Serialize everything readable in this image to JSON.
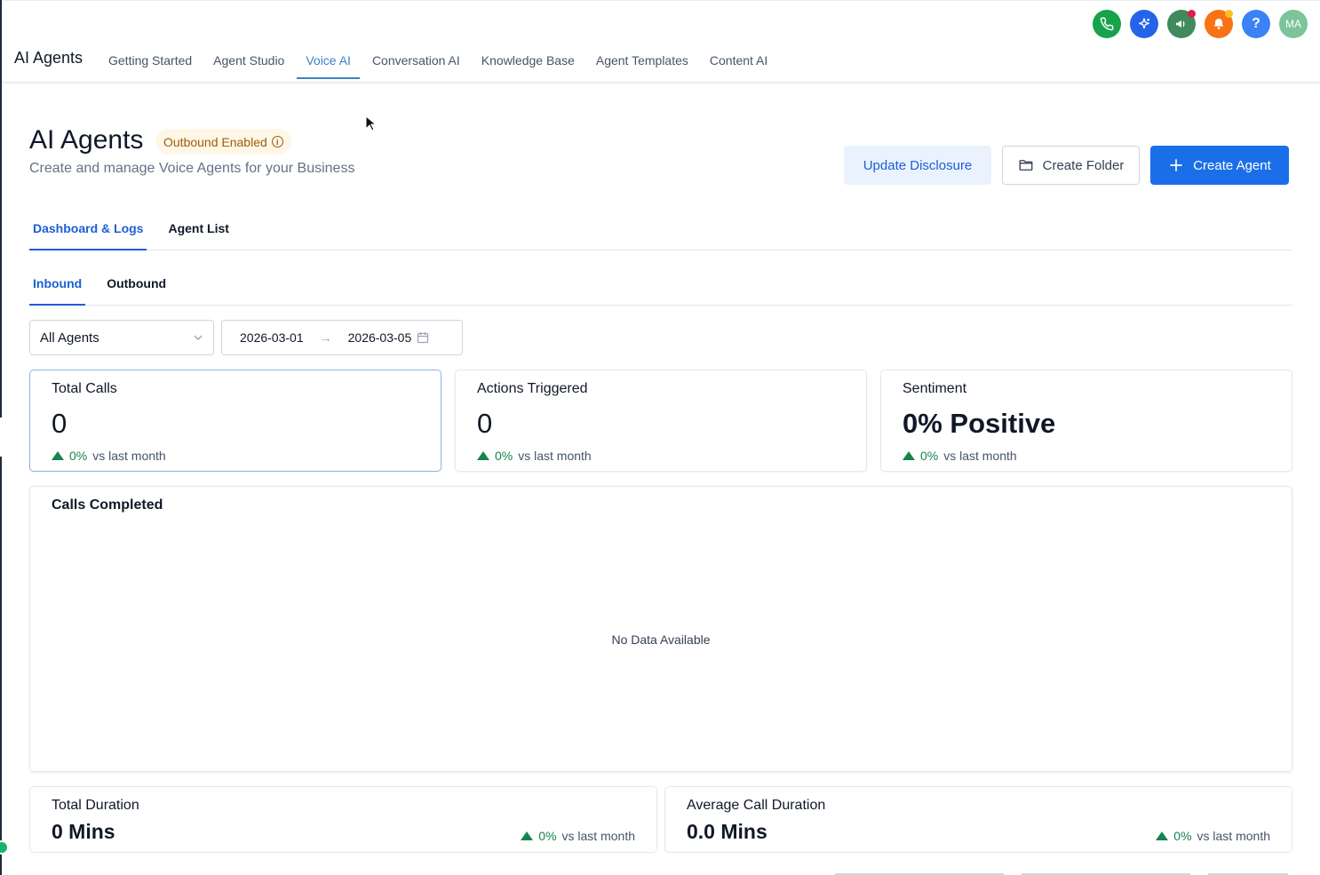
{
  "header": {
    "app_title": "AI Agents",
    "nav": [
      {
        "label": "Getting Started",
        "active": false
      },
      {
        "label": "Agent Studio",
        "active": false
      },
      {
        "label": "Voice AI",
        "active": true
      },
      {
        "label": "Conversation AI",
        "active": false
      },
      {
        "label": "Knowledge Base",
        "active": false
      },
      {
        "label": "Agent Templates",
        "active": false
      },
      {
        "label": "Content AI",
        "active": false
      }
    ],
    "icons": [
      "phone-icon",
      "ai-sparkle-icon",
      "megaphone-icon",
      "bell-icon",
      "help-icon",
      "avatar"
    ],
    "help_glyph": "?",
    "avatar_initials": "MA"
  },
  "page": {
    "title": "AI Agents",
    "badge": "Outbound Enabled",
    "badge_info_glyph": "i",
    "subtitle": "Create and manage Voice Agents for your Business",
    "buttons": {
      "update_disclosure": "Update Disclosure",
      "create_folder": "Create Folder",
      "create_agent": "Create Agent"
    }
  },
  "tabs": {
    "primary": [
      {
        "label": "Dashboard & Logs",
        "active": true
      },
      {
        "label": "Agent List",
        "active": false
      }
    ],
    "secondary": [
      {
        "label": "Inbound",
        "active": true
      },
      {
        "label": "Outbound",
        "active": false
      }
    ]
  },
  "filters": {
    "agent_select": "All Agents",
    "date_from": "2026-03-01",
    "date_arrow": "→",
    "date_to": "2026-03-05"
  },
  "stats": [
    {
      "label": "Total Calls",
      "value": "0",
      "trend_pct": "0%",
      "trend_text": "vs last month"
    },
    {
      "label": "Actions Triggered",
      "value": "0",
      "trend_pct": "0%",
      "trend_text": "vs last month"
    },
    {
      "label": "Sentiment",
      "value": "0% Positive",
      "trend_pct": "0%",
      "trend_text": "vs last month"
    }
  ],
  "calls_completed": {
    "title": "Calls Completed",
    "empty_text": "No Data Available"
  },
  "durations": [
    {
      "label": "Total Duration",
      "value": "0 Mins",
      "trend_pct": "0%",
      "trend_text": "vs last month"
    },
    {
      "label": "Average Call Duration",
      "value": "0.0 Mins",
      "trend_pct": "0%",
      "trend_text": "vs last month"
    }
  ],
  "colors": {
    "primary": "#1a6fe8",
    "accent_nav": "#3b82c4",
    "trend_up": "#17834e",
    "badge_bg": "#fef6e7",
    "badge_text": "#a15c07"
  }
}
